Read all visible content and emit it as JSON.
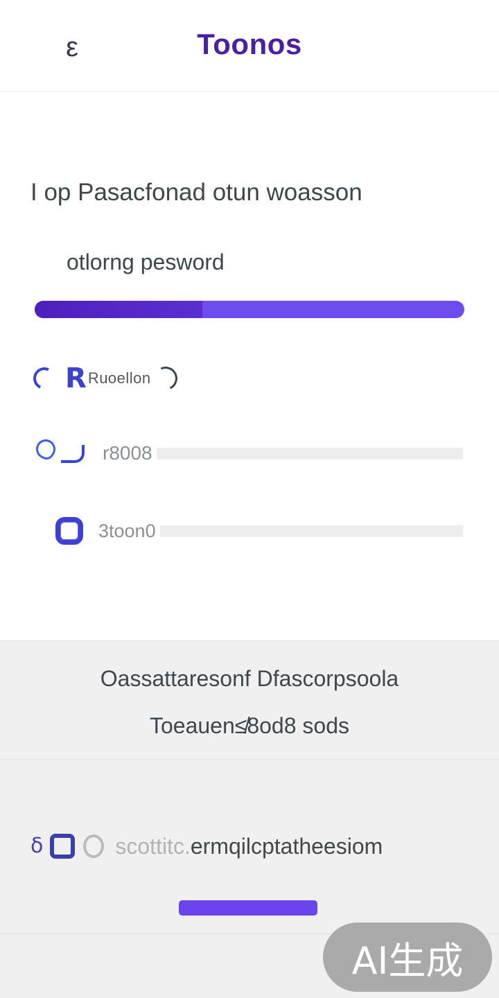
{
  "header": {
    "back_glyph": "ε",
    "title": "Toonos"
  },
  "main": {
    "section_title": "I op Pasacfonad otun woasson",
    "subtitle": "otlorng pesword",
    "strength_bar": {
      "fill_fraction": 0.39,
      "colors": {
        "filled": "#4f1fbd",
        "track": "#6c4bef"
      }
    },
    "rows": [
      {
        "label": "Ruoellon",
        "icons": [
          "arc-icon",
          "r-letter-icon",
          "close-arc-icon"
        ]
      },
      {
        "value": "r8008",
        "icon": "fingerprint-icon"
      },
      {
        "value": "3toon0",
        "icon": "ring-icon"
      }
    ]
  },
  "footer": {
    "info_line_1": "Oassattaresonf Dfascorpsoola",
    "info_line_2": "Toeauen≰8od8 sods",
    "bottom_prefix": "δ",
    "bottom_text_light": "scottitc.",
    "bottom_text_dark": "ermqilcptatheesiom",
    "action_button_label": "",
    "watermark": "AI生成"
  },
  "colors": {
    "brand": "#4a1fa0",
    "accent": "#6a45ee",
    "icon_blue": "#3a44d6"
  }
}
